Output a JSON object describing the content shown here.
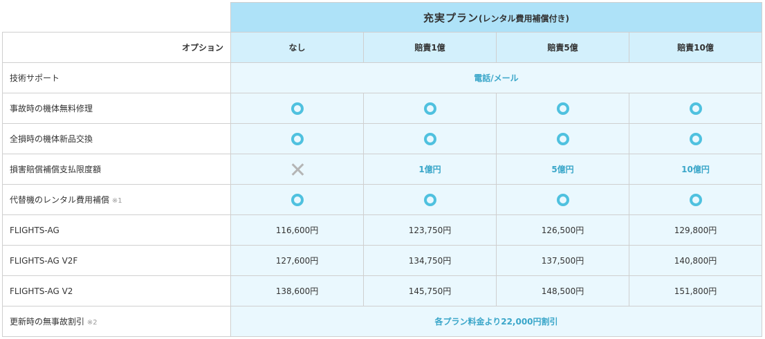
{
  "plan": {
    "title": "充実プラン",
    "subtitle": "(レンタル費用補償付き)"
  },
  "options": {
    "label": "オプション",
    "columns": [
      "なし",
      "賠責1億",
      "賠責5億",
      "賠責10億"
    ]
  },
  "rows": {
    "support": {
      "label": "技術サポート",
      "value": "電話/メール"
    },
    "repair": {
      "label": "事故時の機体無料修理",
      "marks": [
        "circle-icon",
        "circle-icon",
        "circle-icon",
        "circle-icon"
      ]
    },
    "exchange": {
      "label": "全損時の機体新品交換",
      "marks": [
        "circle-icon",
        "circle-icon",
        "circle-icon",
        "circle-icon"
      ]
    },
    "liability": {
      "label": "損害賠償補償支払限度額",
      "mark": "cross-icon",
      "values": [
        "1億円",
        "5億円",
        "10億円"
      ]
    },
    "rental": {
      "label": "代替機のレンタル費用補償",
      "note": "※1",
      "marks": [
        "circle-icon",
        "circle-icon",
        "circle-icon",
        "circle-icon"
      ]
    },
    "ag": {
      "label": "FLIGHTS-AG",
      "prices": [
        "116,600円",
        "123,750円",
        "126,500円",
        "129,800円"
      ]
    },
    "v2f": {
      "label": "FLIGHTS-AG V2F",
      "prices": [
        "127,600円",
        "134,750円",
        "137,500円",
        "140,800円"
      ]
    },
    "v2": {
      "label": "FLIGHTS-AG V2",
      "prices": [
        "138,600円",
        "145,750円",
        "148,500円",
        "151,800円"
      ]
    },
    "renewal": {
      "label": "更新時の無事故割引",
      "note": "※2",
      "value": "各プラン料金より22,000円割引"
    }
  },
  "colors": {
    "header": "#aee2f8",
    "option_header": "#d3f0fc",
    "cell_bg": "#eaf8fe",
    "accent_text": "#3aa6c9",
    "circle": "#4fc1df",
    "cross": "#b5b5b5",
    "border": "#cfcfcf"
  }
}
